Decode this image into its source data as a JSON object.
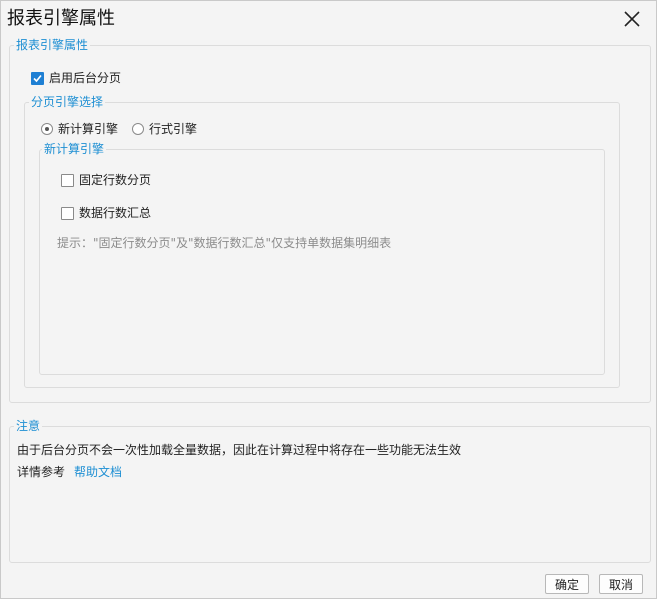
{
  "dialog": {
    "title": "报表引擎属性",
    "close_icon": "close-icon"
  },
  "engine_group": {
    "legend": "报表引擎属性",
    "enable_backend_paging": {
      "label": "启用后台分页",
      "checked": true
    },
    "paging_engine": {
      "legend": "分页引擎选择",
      "options": [
        {
          "label": "新计算引擎",
          "selected": true
        },
        {
          "label": "行式引擎",
          "selected": false
        }
      ],
      "new_engine": {
        "legend": "新计算引擎",
        "fixed_rows_paging": {
          "label": "固定行数分页",
          "checked": false
        },
        "rows_summary": {
          "label": "数据行数汇总",
          "checked": false
        },
        "hint": "提示：\"固定行数分页\"及\"数据行数汇总\"仅支持单数据集明细表"
      }
    }
  },
  "notice_group": {
    "legend": "注意",
    "message": "由于后台分页不会一次性加载全量数据，因此在计算过程中将存在一些功能无法生效",
    "reference_label": "详情参考",
    "help_link": "帮助文档"
  },
  "footer": {
    "ok_label": "确定",
    "cancel_label": "取消"
  },
  "colors": {
    "accent": "#1e8fd3",
    "checkbox_checked": "#1e7fd3",
    "hint_text": "#8c8c8c"
  }
}
